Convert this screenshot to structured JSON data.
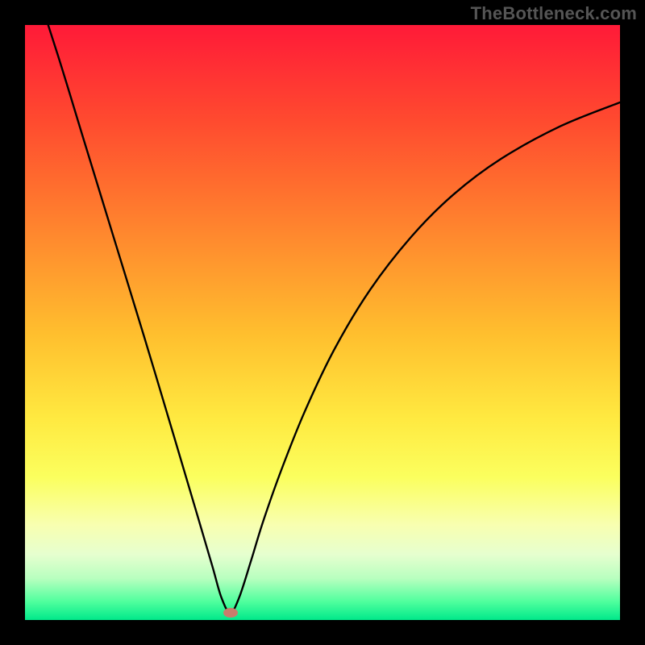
{
  "watermark": "TheBottleneck.com",
  "chart_data": {
    "type": "line",
    "title": "",
    "xlabel": "",
    "ylabel": "",
    "xlim": [
      0,
      100
    ],
    "ylim": [
      0,
      100
    ],
    "gradient_stops": [
      {
        "pos": 0,
        "color": "#ff1a38"
      },
      {
        "pos": 16,
        "color": "#ff4a2f"
      },
      {
        "pos": 34,
        "color": "#ff842e"
      },
      {
        "pos": 52,
        "color": "#ffbf2e"
      },
      {
        "pos": 66,
        "color": "#ffe940"
      },
      {
        "pos": 76,
        "color": "#fbff5e"
      },
      {
        "pos": 84,
        "color": "#f8ffb0"
      },
      {
        "pos": 89,
        "color": "#e6ffcf"
      },
      {
        "pos": 93,
        "color": "#b8ffbf"
      },
      {
        "pos": 97,
        "color": "#4dff9d"
      },
      {
        "pos": 100,
        "color": "#00e88a"
      }
    ],
    "series": [
      {
        "name": "bottleneck-curve",
        "x": [
          0,
          5.5,
          10,
          15,
          20,
          25,
          29,
          31.5,
          33,
          34.5,
          36,
          38,
          40,
          43,
          47,
          52,
          58,
          65,
          72,
          80,
          90,
          100
        ],
        "y": [
          112,
          95,
          80.3,
          64,
          47.7,
          31,
          17.5,
          9,
          3.8,
          1.2,
          3.8,
          10,
          16.5,
          25,
          35,
          45.5,
          55.5,
          64.5,
          71.5,
          77.5,
          83,
          87
        ]
      }
    ],
    "marker": {
      "x": 34.5,
      "y": 1.2,
      "color": "#c97c6c"
    }
  }
}
